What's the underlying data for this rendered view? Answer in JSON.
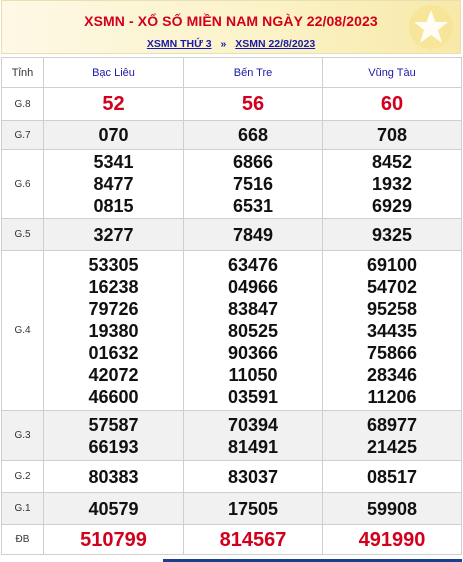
{
  "header": {
    "title": "XSMN - XỔ SỐ MIỀN NAM NGÀY 22/08/2023",
    "link1": "XSMN THỨ 3",
    "separator": "»",
    "link2": "XSMN 22/8/2023"
  },
  "table": {
    "rank_header": "Tỉnh",
    "provinces": [
      "Bạc Liêu",
      "Bến Tre",
      "Vũng Tàu"
    ],
    "rows": [
      {
        "rank": "G.8",
        "values": [
          [
            "52"
          ],
          [
            "56"
          ],
          [
            "60"
          ]
        ]
      },
      {
        "rank": "G.7",
        "values": [
          [
            "070"
          ],
          [
            "668"
          ],
          [
            "708"
          ]
        ]
      },
      {
        "rank": "G.6",
        "values": [
          [
            "5341",
            "8477",
            "0815"
          ],
          [
            "6866",
            "7516",
            "6531"
          ],
          [
            "8452",
            "1932",
            "6929"
          ]
        ]
      },
      {
        "rank": "G.5",
        "values": [
          [
            "3277"
          ],
          [
            "7849"
          ],
          [
            "9325"
          ]
        ]
      },
      {
        "rank": "G.4",
        "values": [
          [
            "53305",
            "16238",
            "79726",
            "19380",
            "01632",
            "42072",
            "46600"
          ],
          [
            "63476",
            "04966",
            "83847",
            "80525",
            "90366",
            "11050",
            "03591"
          ],
          [
            "69100",
            "54702",
            "95258",
            "34435",
            "75866",
            "28346",
            "11206"
          ]
        ]
      },
      {
        "rank": "G.3",
        "values": [
          [
            "57587",
            "66193"
          ],
          [
            "70394",
            "81491"
          ],
          [
            "68977",
            "21425"
          ]
        ]
      },
      {
        "rank": "G.2",
        "values": [
          [
            "80383"
          ],
          [
            "83037"
          ],
          [
            "08517"
          ]
        ]
      },
      {
        "rank": "G.1",
        "values": [
          [
            "40579"
          ],
          [
            "17505"
          ],
          [
            "59908"
          ]
        ]
      },
      {
        "rank": "ĐB",
        "values": [
          [
            "510799"
          ],
          [
            "814567"
          ],
          [
            "491990"
          ]
        ]
      }
    ]
  },
  "colors": {
    "accent_red": "#d2001c",
    "link_blue": "#1a1aa6",
    "header_bg": "#fbf2c6"
  }
}
